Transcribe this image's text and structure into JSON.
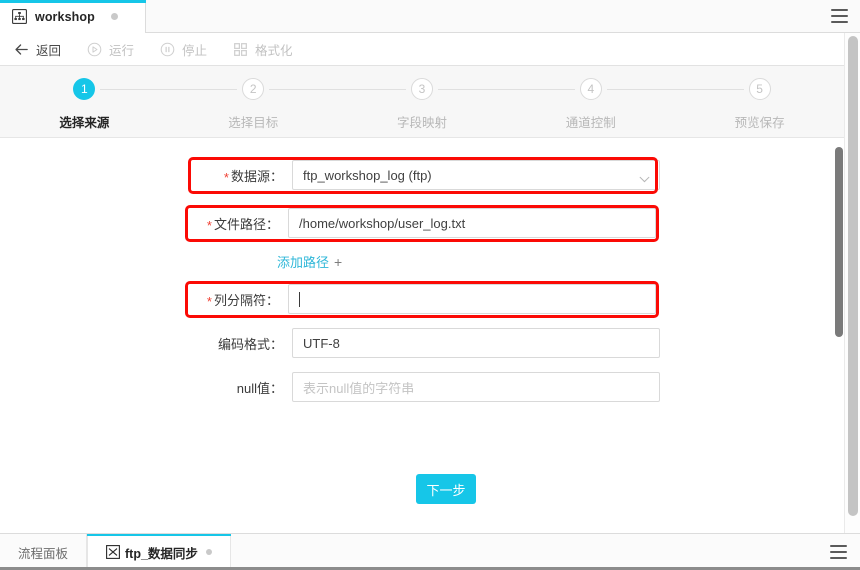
{
  "window": {
    "tab": {
      "icon": "flow-hierarchy-icon",
      "label": "workshop",
      "modified_dot": true
    },
    "menu_icon": "hamburger-menu-icon"
  },
  "toolbar": {
    "items": [
      {
        "icon": "arrow-left-icon",
        "label": "返回",
        "disabled": false
      },
      {
        "icon": "play-circle-icon",
        "label": "运行",
        "disabled": true
      },
      {
        "icon": "pause-circle-icon",
        "label": "停止",
        "disabled": true
      },
      {
        "icon": "grid-squares-icon",
        "label": "格式化",
        "disabled": true
      }
    ]
  },
  "stepper": {
    "steps": [
      {
        "number": "1",
        "label": "选择来源",
        "state": "active"
      },
      {
        "number": "2",
        "label": "选择目标",
        "state": "idle"
      },
      {
        "number": "3",
        "label": "字段映射",
        "state": "idle"
      },
      {
        "number": "4",
        "label": "通道控制",
        "state": "idle"
      },
      {
        "number": "5",
        "label": "预览保存",
        "state": "idle"
      }
    ]
  },
  "form": {
    "datasource": {
      "label": "数据源：",
      "required": true,
      "value": "ftp_workshop_log (ftp)",
      "control": "select",
      "highlighted": true
    },
    "filepath": {
      "label": "文件路径：",
      "required": true,
      "value": "/home/workshop/user_log.txt",
      "control": "input",
      "highlighted": true
    },
    "add_path": {
      "text": "添加路径",
      "plus": "+"
    },
    "delimiter": {
      "label": "列分隔符：",
      "required": true,
      "value": "",
      "control": "input",
      "focused": true,
      "highlighted": true
    },
    "encoding": {
      "label": "编码格式：",
      "required": false,
      "value": "UTF-8",
      "control": "input",
      "highlighted": false
    },
    "nullvalue": {
      "label": "null值：",
      "required": false,
      "value": "",
      "placeholder": "表示null值的字符串",
      "control": "input",
      "highlighted": false
    }
  },
  "actions": {
    "next_label": "下一步"
  },
  "bottom": {
    "tabs": [
      {
        "label": "流程面板",
        "active": false,
        "icon": null,
        "dot": false
      },
      {
        "label": "ftp_数据同步",
        "active": true,
        "icon": "shuffle-box-icon",
        "dot": true
      }
    ],
    "menu_icon": "hamburger-menu-icon"
  },
  "colors": {
    "accent": "#16c6e8",
    "annotation": "#fb0a05",
    "required": "#f04134",
    "link": "#2fb7d8"
  }
}
